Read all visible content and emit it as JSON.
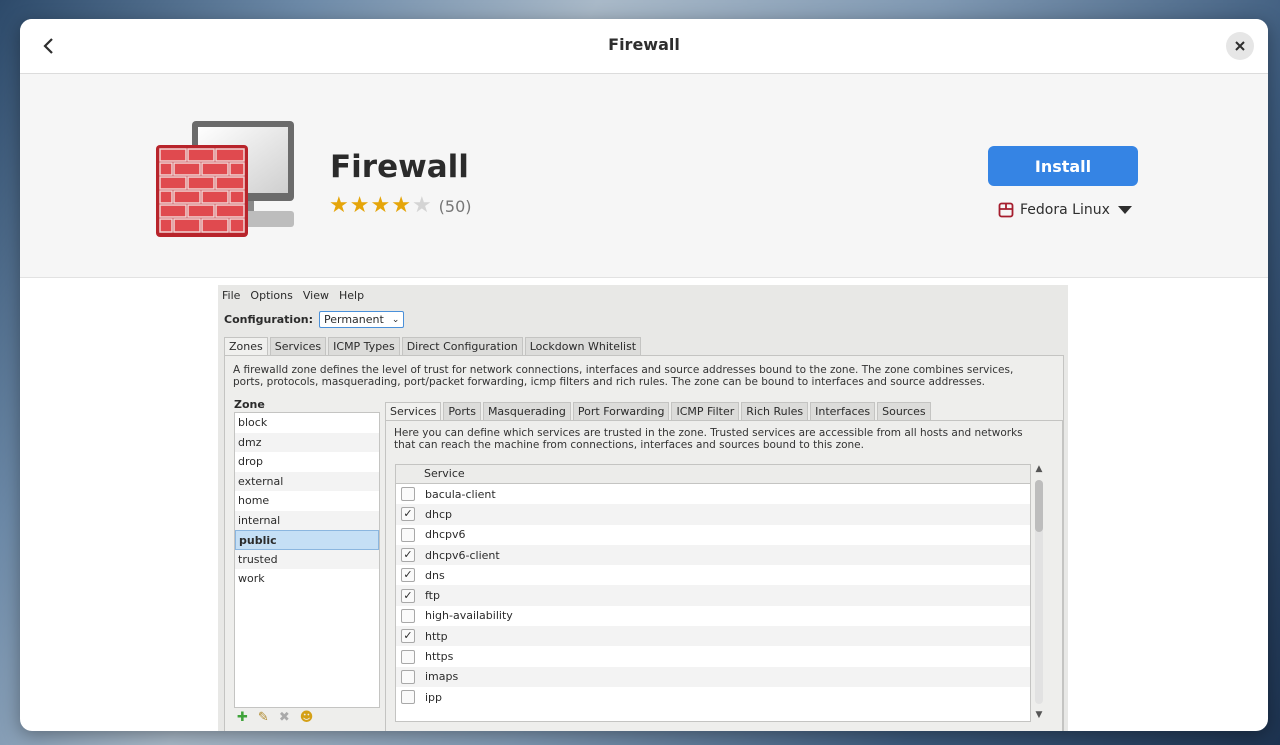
{
  "window": {
    "title": "Firewall"
  },
  "app": {
    "name": "Firewall",
    "rating_stars": 4,
    "rating_max": 5,
    "review_count": "(50)",
    "install_label": "Install",
    "source": "Fedora Linux"
  },
  "colors": {
    "accent": "#3584e4",
    "star": "#e5a50a"
  },
  "screenshot": {
    "menu": [
      "File",
      "Options",
      "View",
      "Help"
    ],
    "config_label": "Configuration:",
    "config_value": "Permanent",
    "tabs": [
      "Zones",
      "Services",
      "ICMP Types",
      "Direct Configuration",
      "Lockdown Whitelist"
    ],
    "zone_description": "A firewalld zone defines the level of trust for network connections, interfaces and source addresses bound to the zone. The zone combines services, ports, protocols, masquerading, port/packet forwarding, icmp filters and rich rules. The zone can be bound to interfaces and source addresses.",
    "zone_header": "Zone",
    "zones": [
      "block",
      "dmz",
      "drop",
      "external",
      "home",
      "internal",
      "public",
      "trusted",
      "work"
    ],
    "zone_tabs": [
      "Services",
      "Ports",
      "Masquerading",
      "Port Forwarding",
      "ICMP Filter",
      "Rich Rules",
      "Interfaces",
      "Sources"
    ],
    "services_description": "Here you can define which services are trusted in the zone. Trusted services are accessible from all hosts and networks that can reach the machine from connections, interfaces and sources bound to this zone.",
    "service_column": "Service",
    "services": [
      {
        "name": "bacula-client",
        "checked": false
      },
      {
        "name": "dhcp",
        "checked": true
      },
      {
        "name": "dhcpv6",
        "checked": false
      },
      {
        "name": "dhcpv6-client",
        "checked": true
      },
      {
        "name": "dns",
        "checked": true
      },
      {
        "name": "ftp",
        "checked": true
      },
      {
        "name": "high-availability",
        "checked": false
      },
      {
        "name": "http",
        "checked": true
      },
      {
        "name": "https",
        "checked": false
      },
      {
        "name": "imaps",
        "checked": false
      },
      {
        "name": "ipp",
        "checked": false
      }
    ]
  }
}
